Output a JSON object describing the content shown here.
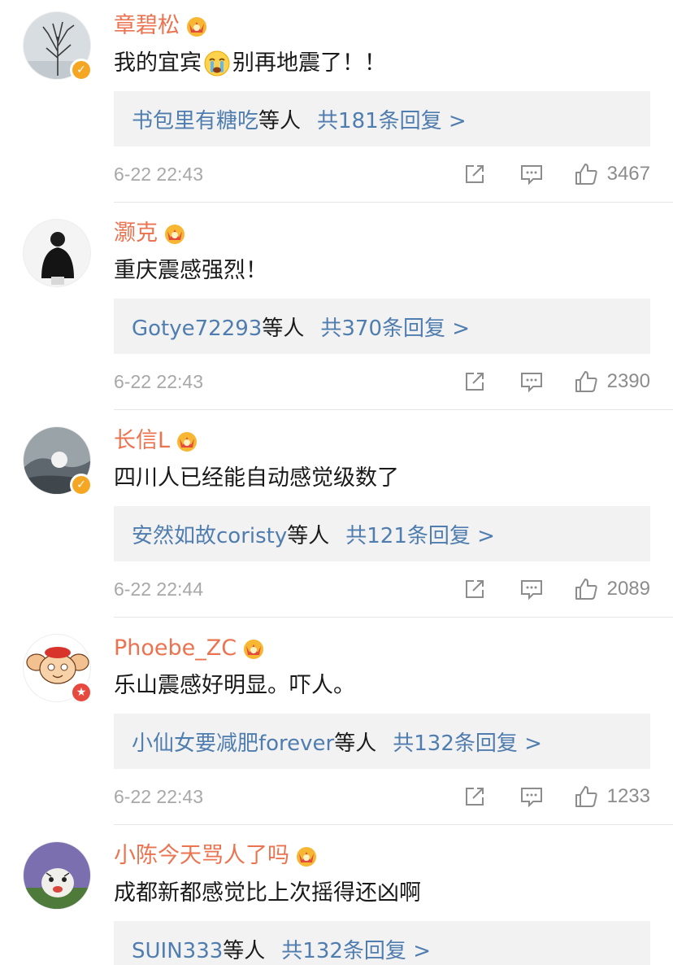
{
  "colors": {
    "username": "#eb7350",
    "reply_link": "#507daf",
    "reply_bg": "#f2f2f2",
    "meta": "#a8a8a8",
    "verified_gold": "#f5a623",
    "verified_red": "#e8493e"
  },
  "comments": [
    {
      "username": "章碧松",
      "verified": "gold-v-badge",
      "text_before": "我的宜宾",
      "emoji": "crying-face-emoji",
      "text_after": "别再地震了！！",
      "reply_users": "书包里有糖吃",
      "reply_suffix": "等人",
      "reply_count": "共181条回复 >",
      "time": "6-22 22:43",
      "likes": "3467"
    },
    {
      "username": "灏克",
      "verified": "",
      "text_before": "重庆震感强烈！",
      "emoji": "",
      "text_after": "",
      "reply_users": "Gotye72293",
      "reply_suffix": "等人",
      "reply_count": "共370条回复 >",
      "time": "6-22 22:43",
      "likes": "2390"
    },
    {
      "username": "长信L",
      "verified": "gold-v-badge",
      "text_before": "四川人已经能自动感觉级数了",
      "emoji": "",
      "text_after": "",
      "reply_users": "安然如故coristy",
      "reply_suffix": "等人",
      "reply_count": "共121条回复 >",
      "time": "6-22 22:44",
      "likes": "2089"
    },
    {
      "username": "Phoebe_ZC",
      "verified": "red-star-badge",
      "text_before": "乐山震感好明显。吓人。",
      "emoji": "",
      "text_after": "",
      "reply_users": "小仙女要减肥forever",
      "reply_suffix": "等人",
      "reply_count": "共132条回复 >",
      "time": "6-22 22:43",
      "likes": "1233"
    },
    {
      "username": "小陈今天骂人了吗",
      "verified": "",
      "text_before": "成都新都感觉比上次摇得还凶啊",
      "emoji": "",
      "text_after": "",
      "reply_users": "SUIN333",
      "reply_suffix": "等人",
      "reply_count": "共132条回复 >",
      "time": "",
      "likes": ""
    }
  ]
}
